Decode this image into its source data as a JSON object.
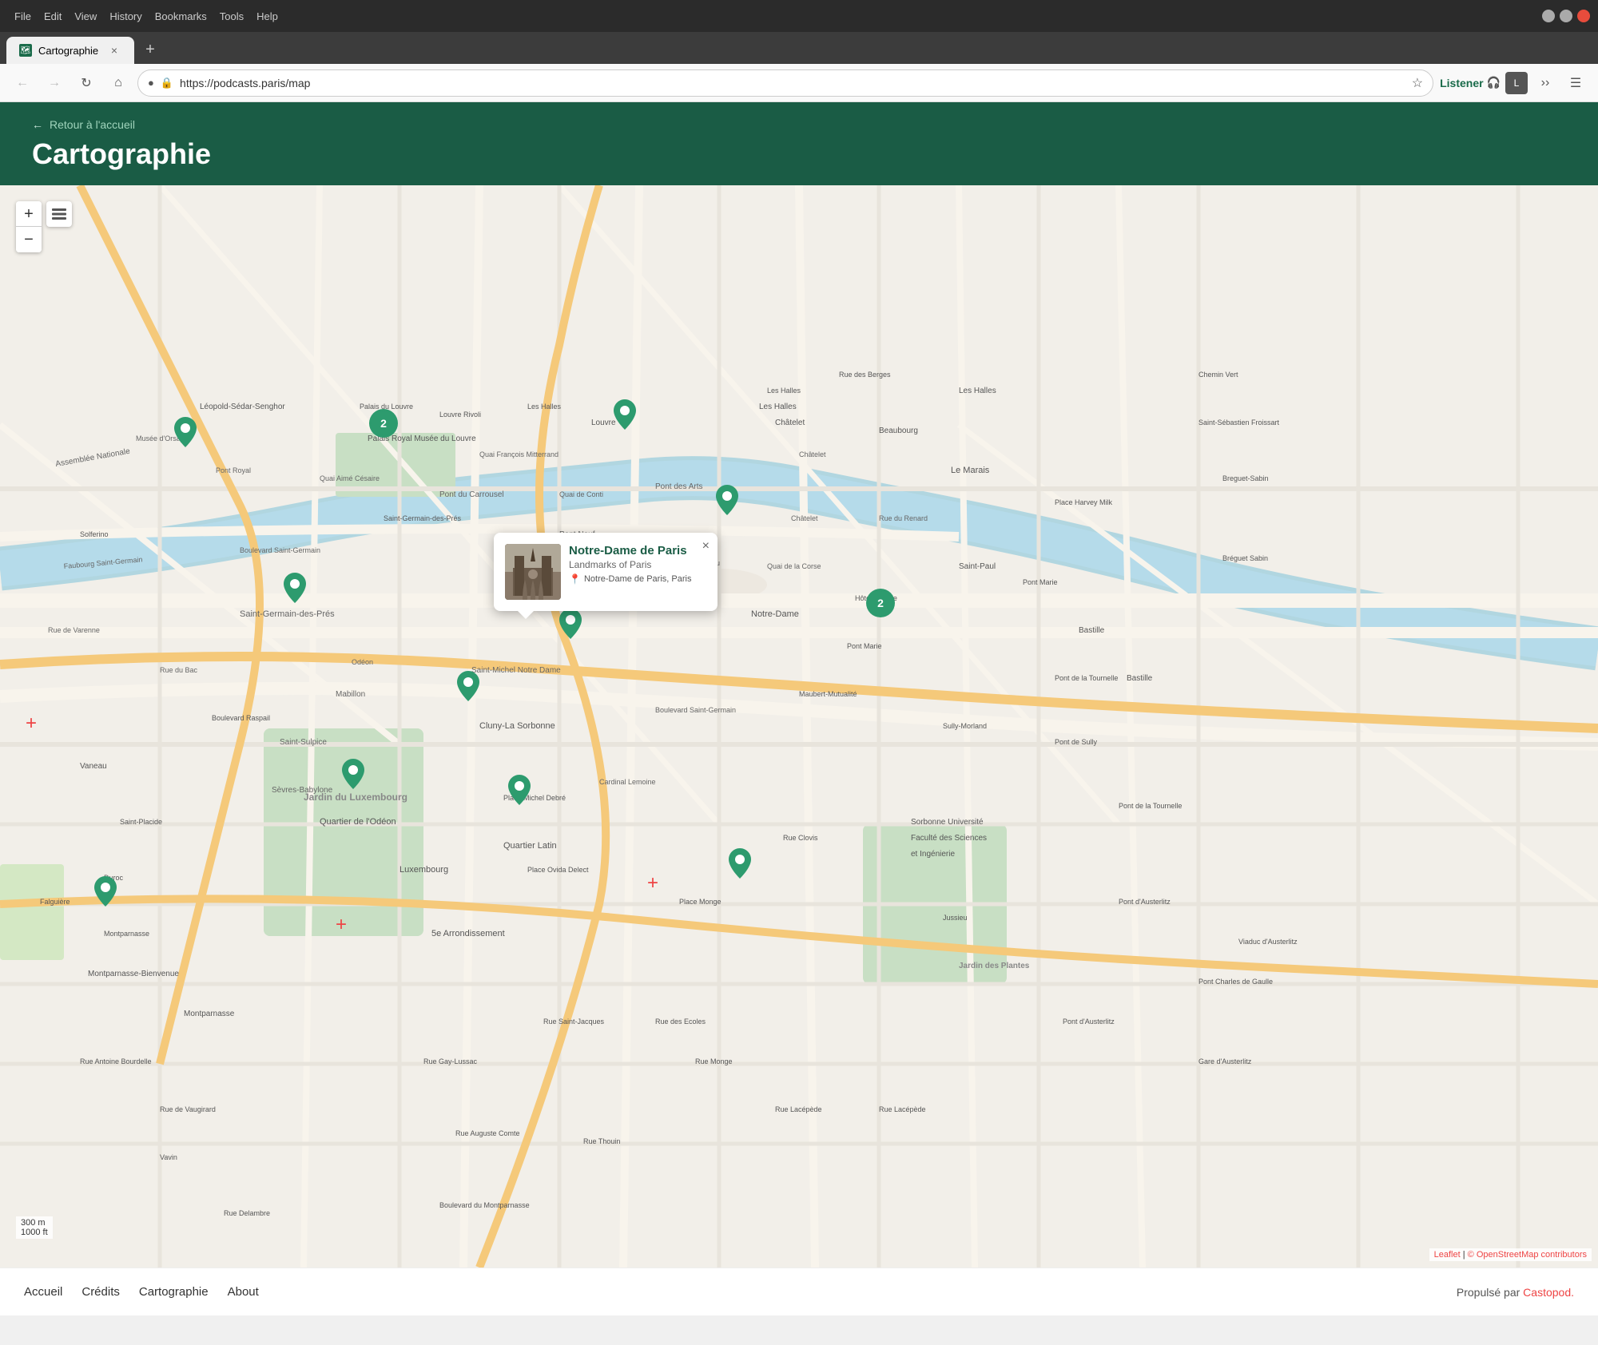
{
  "browser": {
    "menu": [
      "File",
      "Edit",
      "View",
      "History",
      "Bookmarks",
      "Tools",
      "Help"
    ],
    "tab_label": "Cartographie",
    "tab_favicon": "🗺",
    "new_tab_label": "+",
    "nav_back": "←",
    "nav_forward": "→",
    "nav_refresh": "↻",
    "nav_home": "⌂",
    "address_url": "https://podcasts.paris/map",
    "listener_label": "Listener",
    "extension_label": "L",
    "more_label": "≡"
  },
  "page": {
    "back_text": "← Retour à l'accueil",
    "title": "Cartographie",
    "bg_color": "#1a5c45"
  },
  "map": {
    "zoom_in": "+",
    "zoom_out": "−",
    "popup": {
      "title": "Notre-Dame de Paris",
      "subtitle": "Landmarks of Paris",
      "location": "Notre-Dame de Paris, Paris",
      "close": "×"
    },
    "attribution_leaflet": "Leaflet",
    "attribution_osm": "© OpenStreetMap contributors",
    "scale_300m": "300 m",
    "scale_1000ft": "1000 ft"
  },
  "footer": {
    "nav_items": [
      {
        "label": "Accueil",
        "href": "#"
      },
      {
        "label": "Crédits",
        "href": "#"
      },
      {
        "label": "Cartographie",
        "href": "#"
      },
      {
        "label": "About",
        "href": "#"
      }
    ],
    "brand_text": "Propulsé par",
    "brand_link": "Castopod."
  }
}
